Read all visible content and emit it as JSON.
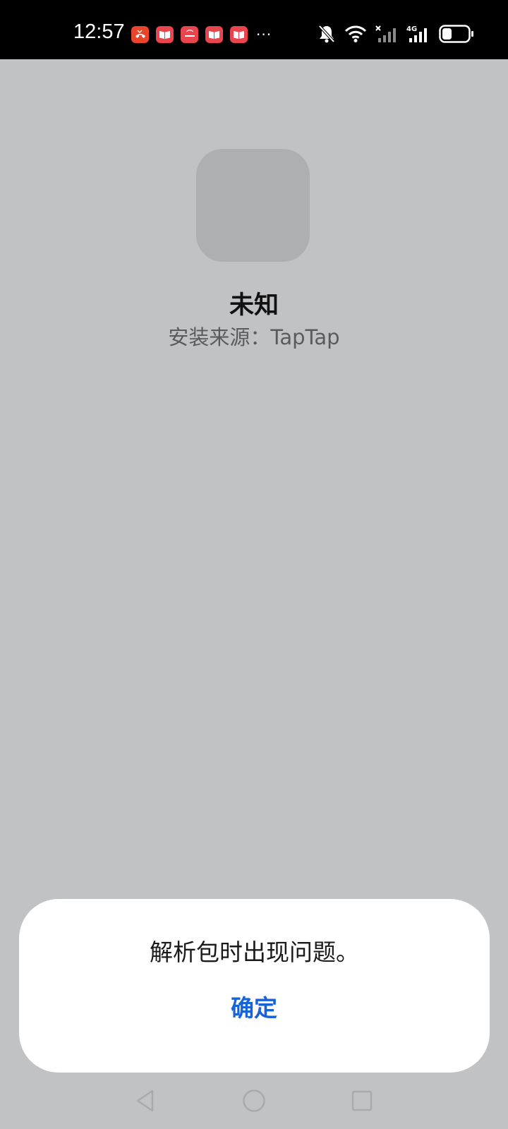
{
  "status_bar": {
    "time": "12:57",
    "notifications": [
      {
        "icon": "missed-call-icon",
        "color": "#e8452c"
      },
      {
        "icon": "book-icon",
        "color": "#e8454f"
      },
      {
        "icon": "huawei-store-icon",
        "color": "#e8454f"
      },
      {
        "icon": "book-icon",
        "color": "#e8454f"
      },
      {
        "icon": "book-icon",
        "color": "#e8454f"
      }
    ],
    "more": "···",
    "signal_type": "4G",
    "battery_level": 0.35
  },
  "app": {
    "name": "未知",
    "install_source": "安装来源：TapTap"
  },
  "dialog": {
    "message": "解析包时出现问题。",
    "confirm_label": "确定",
    "confirm_color": "#1863d6"
  },
  "nav_bar": {
    "back": "back-icon",
    "home": "home-icon",
    "recents": "recents-icon"
  }
}
